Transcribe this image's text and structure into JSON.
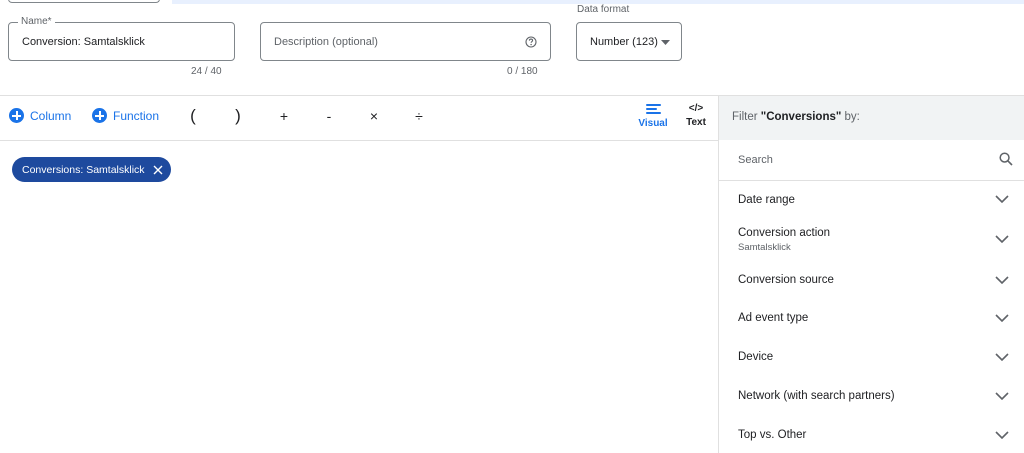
{
  "form": {
    "name_label": "Name*",
    "name_value": "Conversion: Samtalsklick",
    "name_counter": "24 / 40",
    "description_placeholder": "Description (optional)",
    "description_counter": "0 / 180",
    "data_format_label": "Data format",
    "data_format_value": "Number (123)"
  },
  "toolbar": {
    "column_label": "Column",
    "function_label": "Function",
    "operators": [
      "(",
      ")",
      "+",
      "-",
      "×",
      "÷"
    ],
    "visual_label": "Visual",
    "text_label": "Text",
    "text_icon": "</>"
  },
  "editor": {
    "chip_label": "Conversions: Samtalsklick"
  },
  "filter_panel": {
    "title_prefix": "Filter ",
    "title_bold": "\"Conversions\"",
    "title_suffix": " by:",
    "search_placeholder": "Search",
    "items": [
      {
        "label": "Date range",
        "sub": ""
      },
      {
        "label": "Conversion action",
        "sub": "Samtalsklick"
      },
      {
        "label": "Conversion source",
        "sub": ""
      },
      {
        "label": "Ad event type",
        "sub": ""
      },
      {
        "label": "Device",
        "sub": ""
      },
      {
        "label": "Network (with search partners)",
        "sub": ""
      },
      {
        "label": "Top vs. Other",
        "sub": ""
      }
    ]
  },
  "colors": {
    "accent": "#1a73e8",
    "chip": "#1e4a9e",
    "panel_header": "#f1f3f4"
  },
  "icons": [
    "plus-circle-icon",
    "search-icon",
    "chevron-down-icon",
    "close-icon",
    "help-icon",
    "dropdown-arrow-icon",
    "visual-mode-icon",
    "code-icon"
  ]
}
